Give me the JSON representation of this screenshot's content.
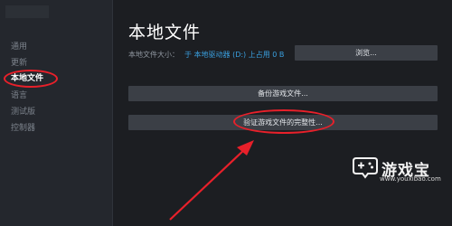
{
  "sidebar": {
    "items": [
      {
        "label": "通用",
        "active": false
      },
      {
        "label": "更新",
        "active": false
      },
      {
        "label": "本地文件",
        "active": true
      },
      {
        "label": "语言",
        "active": false
      },
      {
        "label": "测试版",
        "active": false
      },
      {
        "label": "控制器",
        "active": false
      }
    ]
  },
  "main": {
    "title": "本地文件",
    "size_label": "本地文件大小：",
    "size_value": "于 本地驱动器 (D:) 上占用 0 B",
    "browse_label": "浏览...",
    "backup_label": "备份游戏文件...",
    "verify_label": "验证游戏文件的完整性..."
  },
  "watermark": {
    "name": "游戏宝",
    "url": "www.youxibao.com"
  },
  "colors": {
    "accent_link": "#3aa0e0",
    "annotation_red": "#e8202a",
    "button_bg": "#3b3f46"
  }
}
